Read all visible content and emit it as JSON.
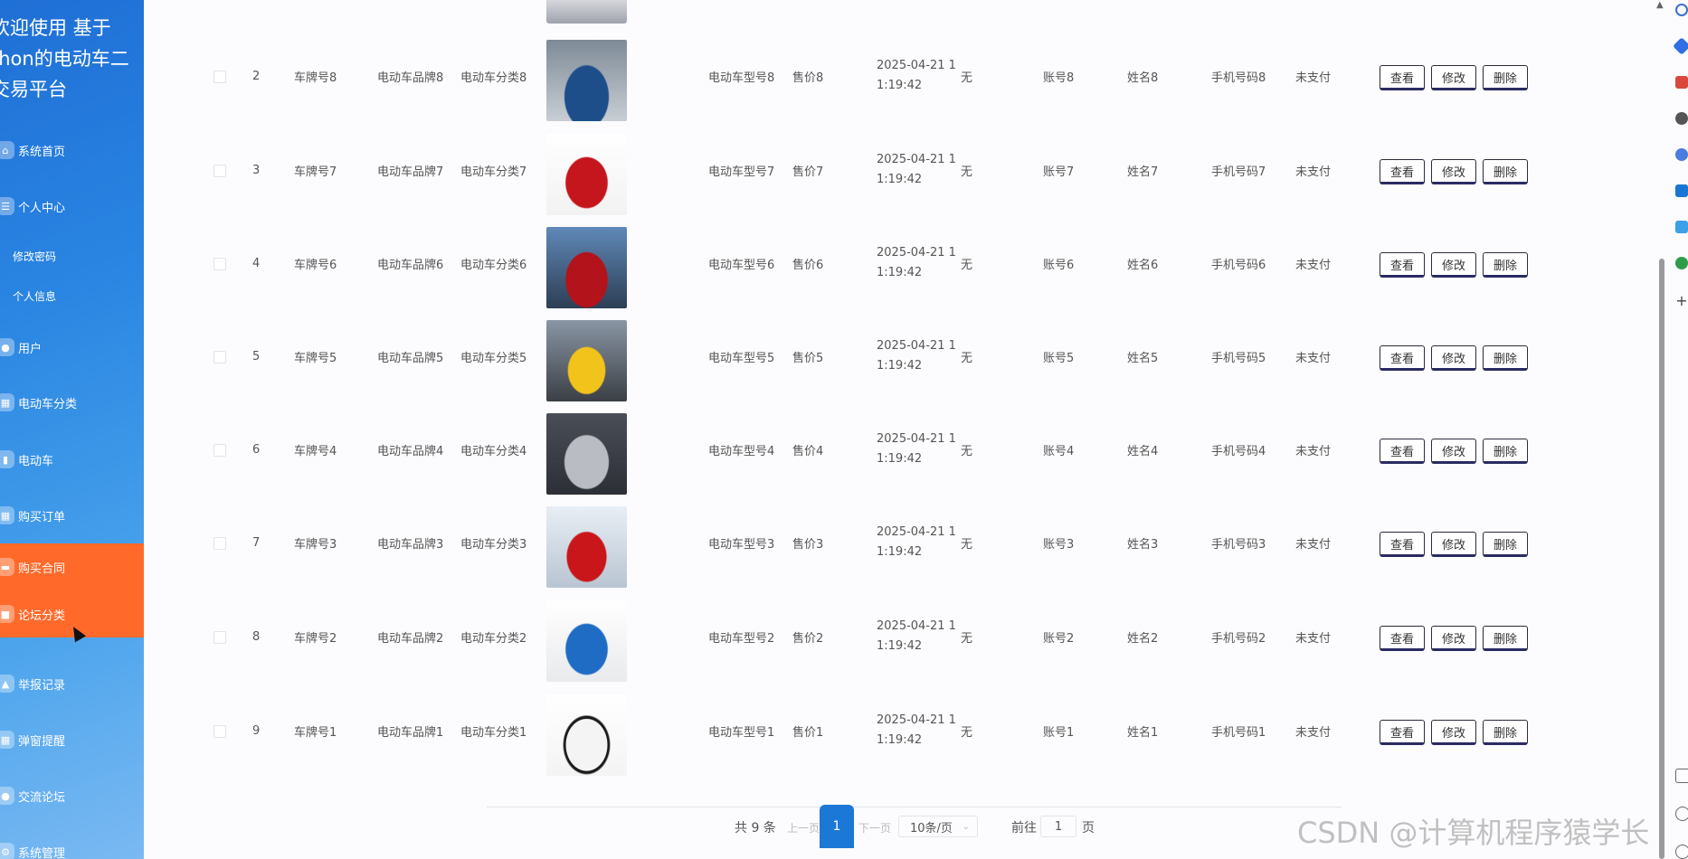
{
  "sidebar": {
    "title_line1": "欢迎使用 基于",
    "title_line2": "thon的电动车二",
    "title_line3": "交易平台",
    "items": [
      {
        "label": "系统首页",
        "icon": "home-icon",
        "type": "main"
      },
      {
        "label": "个人中心",
        "icon": "user-center-icon",
        "type": "main"
      },
      {
        "label": "修改密码",
        "icon": "",
        "type": "sub"
      },
      {
        "label": "个人信息",
        "icon": "",
        "type": "sub"
      },
      {
        "label": "用户",
        "icon": "person-icon",
        "type": "main"
      },
      {
        "label": "电动车分类",
        "icon": "grid-icon",
        "type": "main"
      },
      {
        "label": "电动车",
        "icon": "chart-icon",
        "type": "main"
      },
      {
        "label": "购买订单",
        "icon": "grid-icon",
        "type": "main"
      },
      {
        "label": "购买合同",
        "icon": "chat-icon",
        "type": "main",
        "active": true
      },
      {
        "label": "论坛分类",
        "icon": "doc-icon",
        "type": "main",
        "active": true
      },
      {
        "label": "举报记录",
        "icon": "flag-icon",
        "type": "main"
      },
      {
        "label": "弹窗提醒",
        "icon": "grid-icon",
        "type": "main"
      },
      {
        "label": "交流论坛",
        "icon": "bubble-icon",
        "type": "main"
      },
      {
        "label": "系统管理",
        "icon": "settings-icon",
        "type": "main"
      }
    ],
    "active_color": "#ff6a2b"
  },
  "table": {
    "rows": [
      {
        "idx": "2",
        "plate": "车牌号8",
        "brand": "电动车品牌8",
        "category": "电动车分类8",
        "model": "电动车型号8",
        "price": "售价8",
        "date1": "2025-04-21 1",
        "date2": "1:19:42",
        "remark": "无",
        "account": "账号8",
        "name": "姓名8",
        "phone": "手机号码8",
        "status": "未支付",
        "img": "blue-sedan"
      },
      {
        "idx": "3",
        "plate": "车牌号7",
        "brand": "电动车品牌7",
        "category": "电动车分类7",
        "model": "电动车型号7",
        "price": "售价7",
        "date1": "2025-04-21 1",
        "date2": "1:19:42",
        "remark": "无",
        "account": "账号7",
        "name": "姓名7",
        "phone": "手机号码7",
        "status": "未支付",
        "img": "red-hatchback"
      },
      {
        "idx": "4",
        "plate": "车牌号6",
        "brand": "电动车品牌6",
        "category": "电动车分类6",
        "model": "电动车型号6",
        "price": "售价6",
        "date1": "2025-04-21 1",
        "date2": "1:19:42",
        "remark": "无",
        "account": "账号6",
        "name": "姓名6",
        "phone": "手机号码6",
        "status": "未支付",
        "img": "red-sedan"
      },
      {
        "idx": "5",
        "plate": "车牌号5",
        "brand": "电动车品牌5",
        "category": "电动车分类5",
        "model": "电动车型号5",
        "price": "售价5",
        "date1": "2025-04-21 1",
        "date2": "1:19:42",
        "remark": "无",
        "account": "账号5",
        "name": "姓名5",
        "phone": "手机号码5",
        "status": "未支付",
        "img": "yellow-suv"
      },
      {
        "idx": "6",
        "plate": "车牌号4",
        "brand": "电动车品牌4",
        "category": "电动车分类4",
        "model": "电动车型号4",
        "price": "售价4",
        "date1": "2025-04-21 1",
        "date2": "1:19:42",
        "remark": "无",
        "account": "账号4",
        "name": "姓名4",
        "phone": "手机号码4",
        "status": "未支付",
        "img": "silver-coupe"
      },
      {
        "idx": "7",
        "plate": "车牌号3",
        "brand": "电动车品牌3",
        "category": "电动车分类3",
        "model": "电动车型号3",
        "price": "售价3",
        "date1": "2025-04-21 1",
        "date2": "1:19:42",
        "remark": "无",
        "account": "账号3",
        "name": "姓名3",
        "phone": "手机号码3",
        "status": "未支付",
        "img": "red-sportscar"
      },
      {
        "idx": "8",
        "plate": "车牌号2",
        "brand": "电动车品牌2",
        "category": "电动车分类2",
        "model": "电动车型号2",
        "price": "售价2",
        "date1": "2025-04-21 1",
        "date2": "1:19:42",
        "remark": "无",
        "account": "账号2",
        "name": "姓名2",
        "phone": "手机号码2",
        "status": "未支付",
        "img": "blue-hatchback"
      },
      {
        "idx": "9",
        "plate": "车牌号1",
        "brand": "电动车品牌1",
        "category": "电动车分类1",
        "model": "电动车型号1",
        "price": "售价1",
        "date1": "2025-04-21 1",
        "date2": "1:19:42",
        "remark": "无",
        "account": "账号1",
        "name": "姓名1",
        "phone": "手机号码1",
        "status": "未支付",
        "img": "white-hatchback"
      }
    ],
    "actions": {
      "view": "查看",
      "edit": "修改",
      "delete": "删除"
    }
  },
  "pagination": {
    "total": "共 9 条",
    "prev": "上一页",
    "current": "1",
    "next": "下一页",
    "page_size": "10条/页",
    "goto": "前往",
    "goto_value": "1",
    "page_suffix": "页",
    "accent": "#1c78d6"
  },
  "watermark": "CSDN @计算机程序猿学长"
}
